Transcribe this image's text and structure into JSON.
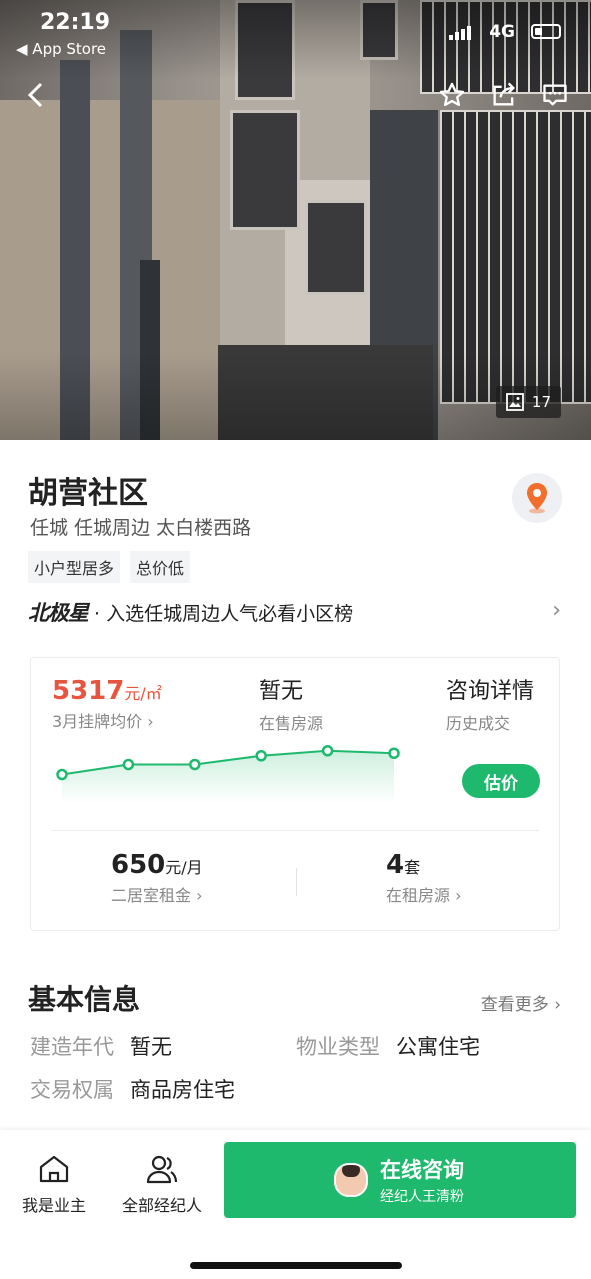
{
  "status_bar": {
    "time": "22:19",
    "back_app": "◀ App Store",
    "network": "4G"
  },
  "hero": {
    "photo_count": "17"
  },
  "community": {
    "name": "胡营社区",
    "address": "任城  任城周边  太白楼西路",
    "tags": [
      "小户型居多",
      "总价低"
    ],
    "polaris_brand": "北极星",
    "polaris_text": "· 入选任城周边人气必看小区榜"
  },
  "price_card": {
    "avg_price": "5317",
    "avg_price_unit": "元/㎡",
    "avg_price_label": "3月挂牌均价 ›",
    "on_sale": "暂无",
    "on_sale_label": "在售房源",
    "consult": "咨询详情",
    "consult_label": "历史成交",
    "estimate_button": "估价",
    "rent": "650",
    "rent_unit": "元/月",
    "rent_label": "二居室租金 ›",
    "rent_count": "4",
    "rent_count_unit": "套",
    "rent_count_label": "在租房源 ›"
  },
  "chart_data": {
    "type": "line",
    "points": 6,
    "values": [
      4.2,
      4.6,
      4.6,
      4.95,
      5.15,
      5.05
    ],
    "color": "#1fb96e"
  },
  "basic_info": {
    "title": "基本信息",
    "more": "查看更多 ›",
    "rows": [
      {
        "key": "建造年代",
        "value": "暂无"
      },
      {
        "key": "物业类型",
        "value": "公寓住宅"
      },
      {
        "key": "交易权属",
        "value": "商品房住宅"
      }
    ]
  },
  "bottom_bar": {
    "owner_tab": "我是业主",
    "agents_tab": "全部经纪人",
    "cta_main": "在线咨询",
    "cta_sub": "经纪人王清粉"
  },
  "colors": {
    "accent": "#1fb96e",
    "price_red": "#e8553e"
  }
}
